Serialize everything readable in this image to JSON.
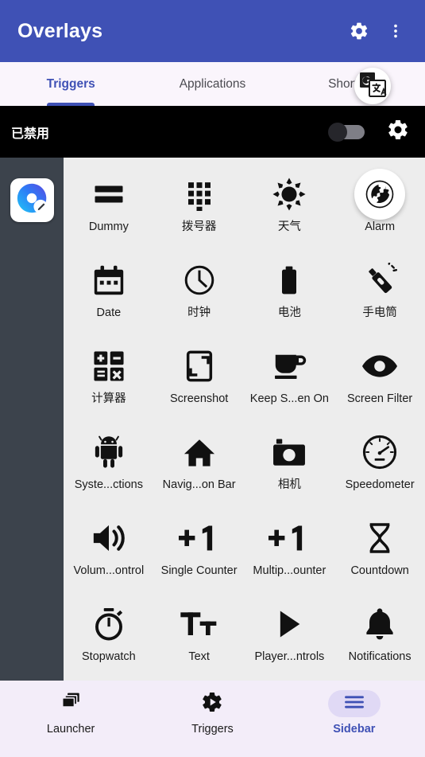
{
  "appbar": {
    "title": "Overlays",
    "settings_icon": "gear-icon",
    "overflow_icon": "more-vertical-icon"
  },
  "tabs": [
    {
      "label": "Triggers",
      "active": true
    },
    {
      "label": "Applications",
      "active": false
    },
    {
      "label": "Shortcuts",
      "active": false
    }
  ],
  "status": {
    "label": "已禁用",
    "toggle_on": false,
    "gear_icon": "gear-icon"
  },
  "side_strip": {
    "app_icon": "overlays-app-icon"
  },
  "grid": {
    "items": [
      {
        "label": "Dummy",
        "icon": "dummy-bars-icon",
        "highlight": false
      },
      {
        "label": "拨号器",
        "icon": "dialpad-icon",
        "highlight": false
      },
      {
        "label": "天气",
        "icon": "weather-sun-icon",
        "highlight": false
      },
      {
        "label": "Alarm",
        "icon": "globe-icon",
        "highlight": true
      },
      {
        "label": "Date",
        "icon": "calendar-icon",
        "highlight": false
      },
      {
        "label": "时钟",
        "icon": "clock-icon",
        "highlight": false
      },
      {
        "label": "电池",
        "icon": "battery-icon",
        "highlight": false
      },
      {
        "label": "手电筒",
        "icon": "flashlight-icon",
        "highlight": false
      },
      {
        "label": "计算器",
        "icon": "calculator-icon",
        "highlight": false
      },
      {
        "label": "Screenshot",
        "icon": "screenshot-icon",
        "highlight": false
      },
      {
        "label": "Keep S...en On",
        "icon": "coffee-cup-icon",
        "highlight": false
      },
      {
        "label": "Screen Filter",
        "icon": "eye-icon",
        "highlight": false
      },
      {
        "label": "Syste...ctions",
        "icon": "android-robot-icon",
        "highlight": false
      },
      {
        "label": "Navig...on Bar",
        "icon": "home-icon",
        "highlight": false
      },
      {
        "label": "相机",
        "icon": "camera-icon",
        "highlight": false
      },
      {
        "label": "Speedometer",
        "icon": "speedometer-icon",
        "highlight": false
      },
      {
        "label": "Volum...ontrol",
        "icon": "volume-up-icon",
        "highlight": false
      },
      {
        "label": "Single Counter",
        "icon": "plus-one-icon",
        "highlight": false
      },
      {
        "label": "Multip...ounter",
        "icon": "plus-one-icon",
        "highlight": false
      },
      {
        "label": "Countdown",
        "icon": "hourglass-icon",
        "highlight": false
      },
      {
        "label": "Stopwatch",
        "icon": "stopwatch-icon",
        "highlight": false
      },
      {
        "label": "Text",
        "icon": "text-format-icon",
        "highlight": false
      },
      {
        "label": "Player...ntrols",
        "icon": "play-triangle-icon",
        "highlight": false
      },
      {
        "label": "Notifications",
        "icon": "bell-icon",
        "highlight": false
      }
    ]
  },
  "bottom_nav": [
    {
      "label": "Launcher",
      "icon": "layers-icon",
      "active": false
    },
    {
      "label": "Triggers",
      "icon": "gear-play-icon",
      "active": false
    },
    {
      "label": "Sidebar",
      "icon": "hamburger-icon",
      "active": true
    }
  ],
  "floating": {
    "translate_bubble_icon": "google-translate-icon"
  },
  "colors": {
    "appbar_blue": "#3F51B5",
    "tabbar_bg": "#FAF5FC",
    "status_bg": "#000000",
    "grid_bg": "#EDEDED",
    "side_strip": "#3C434C",
    "bottom_nav_bg": "#F3EDF9",
    "accent": "#3F51B5",
    "active_pill": "#E0D9F5"
  }
}
